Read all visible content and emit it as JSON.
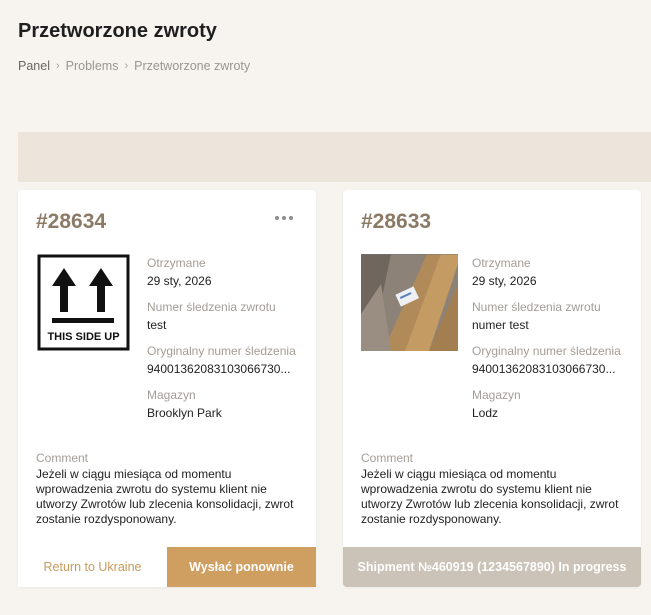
{
  "page": {
    "title": "Przetworzone zwroty",
    "breadcrumb": [
      "Panel",
      "Problems",
      "Przetworzone zwroty"
    ]
  },
  "cards": [
    {
      "id": "#28634",
      "image_icon": "this-side-up-label",
      "image_caption": "THIS SIDE UP",
      "received_label": "Otrzymane",
      "received_value": "29 sty, 2026",
      "tracking_label": "Numer śledzenia zwrotu",
      "tracking_value": "test",
      "orig_tracking_label": "Oryginalny numer śledzenia",
      "orig_tracking_value": "94001362083103066730...",
      "warehouse_label": "Magazyn",
      "warehouse_value": "Brooklyn Park",
      "comment_label": "Comment",
      "comment_text": "Jeżeli w ciągu miesiąca od momentu wprowadzenia zwrotu do systemu klient nie utworzy Zwrotów lub zlecenia konsolidacji, zwrot zostanie rozdysponowany.",
      "secondary_button": "Return to Ukraine",
      "primary_button": "Wysłać ponownie"
    },
    {
      "id": "#28633",
      "image_icon": "package-photo",
      "received_label": "Otrzymane",
      "received_value": "29 sty, 2026",
      "tracking_label": "Numer śledzenia zwrotu",
      "tracking_value": "numer test",
      "orig_tracking_label": "Oryginalny numer śledzenia",
      "orig_tracking_value": "94001362083103066730...",
      "warehouse_label": "Magazyn",
      "warehouse_value": "Lodz",
      "comment_label": "Comment",
      "comment_text": "Jeżeli w ciągu miesiąca od momentu wprowadzenia zwrotu do systemu klient nie utworzy Zwrotów lub zlecenia konsolidacji, zwrot zostanie rozdysponowany.",
      "status_button": "Shipment №460919 (1234567890) In progress"
    }
  ],
  "colors": {
    "background": "#f7f4ef",
    "accent": "#cf9f61",
    "id_text": "#8b7b66",
    "status_gray": "#cbc2b8"
  }
}
